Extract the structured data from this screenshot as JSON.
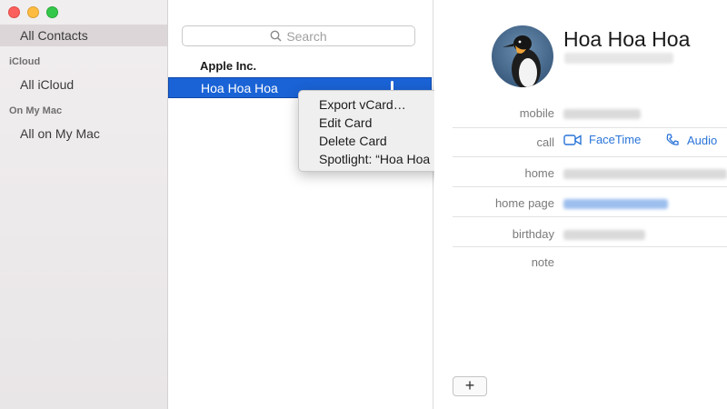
{
  "sidebar": {
    "all_contacts": "All Contacts",
    "group_icloud": "iCloud",
    "all_icloud": "All iCloud",
    "group_mac": "On My Mac",
    "all_on_mac": "All on My Mac"
  },
  "list": {
    "search_placeholder": "Search",
    "company": "Apple Inc.",
    "selected_contact": "Hoa Hoa Hoa"
  },
  "context_menu": {
    "items": [
      "Export vCard…",
      "Edit Card",
      "Delete Card",
      "Spotlight: “Hoa Hoa Hoa”"
    ]
  },
  "detail": {
    "name": "Hoa Hoa Hoa",
    "labels": {
      "mobile": "mobile",
      "call": "call",
      "home": "home",
      "home_page": "home page",
      "birthday": "birthday",
      "note": "note"
    },
    "facetime_label": "FaceTime",
    "audio_label": "Audio",
    "add_button": "+"
  },
  "colors": {
    "selection": "#1a63d6",
    "link": "#2a74d9"
  }
}
